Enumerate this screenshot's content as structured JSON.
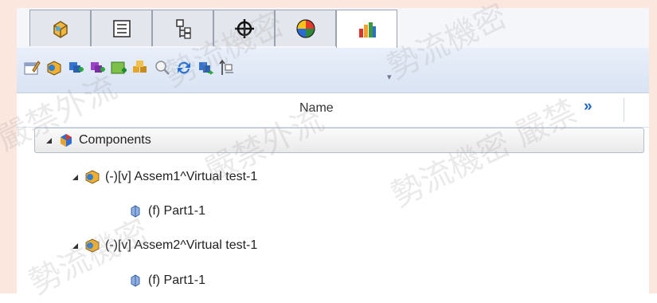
{
  "tabs": [
    {
      "icon": "feature-manager-icon"
    },
    {
      "icon": "property-manager-icon"
    },
    {
      "icon": "configuration-manager-icon"
    },
    {
      "icon": "dimxpert-icon"
    },
    {
      "icon": "display-manager-icon"
    },
    {
      "icon": "assembly-visualization-icon"
    }
  ],
  "active_tab": 5,
  "toolbar": [
    "edit-properties-icon",
    "assembly-icon",
    "add-component-icon",
    "add-copy-icon",
    "new-part-icon",
    "replace-components-icon",
    "zoom-to-fit-icon",
    "refresh-icon",
    "move-component-icon",
    "insert-tree-icon"
  ],
  "header": {
    "column_name": "Name",
    "more_label": "»"
  },
  "tree": {
    "root": "Components",
    "children": [
      {
        "label": "(-)[v] Assem1^Virtual test-1",
        "child": "(f) Part1-1"
      },
      {
        "label": "(-)[v] Assem2^Virtual test-1",
        "child": "(f) Part1-1"
      }
    ]
  },
  "watermarks": [
    "勢流機密",
    "嚴禁外流",
    "勢流機密",
    "嚴禁外流",
    "勢流機密 嚴禁",
    "勢流機密"
  ]
}
